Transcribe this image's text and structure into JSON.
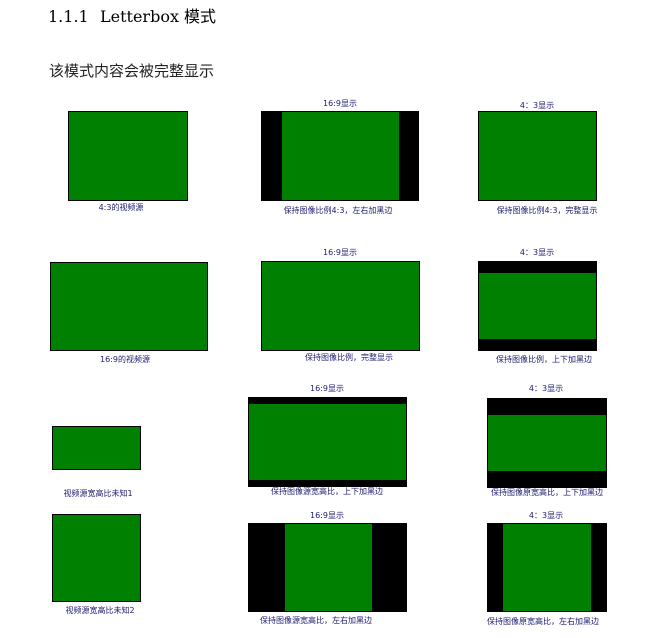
{
  "heading": {
    "number": "1.1.1",
    "title": "Letterbox 模式"
  },
  "subheading": "该模式内容会被完整显示",
  "colors": {
    "content": "#008000",
    "bars": "#000000",
    "caption": "#1a1a6e"
  },
  "rows": [
    {
      "source": {
        "caption": "4:3的视频源"
      },
      "display_169": {
        "title": "16:9显示",
        "caption": "保持图像比例4:3，左右加黑边"
      },
      "display_43": {
        "title": "4：3显示",
        "caption": "保持图像比例4:3，完整显示"
      }
    },
    {
      "source": {
        "caption": "16:9的视频源"
      },
      "display_169": {
        "title": "16:9显示",
        "caption": "保持图像比例，完整显示"
      },
      "display_43": {
        "title": "4：3显示",
        "caption": "保持图像比例，上下加黑边"
      }
    },
    {
      "source": {
        "caption": "视频源宽高比未知1"
      },
      "display_169": {
        "title": "16:9显示",
        "caption": "保持图像源宽高比，上下加黑边"
      },
      "display_43": {
        "title": "4：3显示",
        "caption": "保持图像原宽高比，上下加黑边"
      }
    },
    {
      "source": {
        "caption": "视频源宽高比未知2"
      },
      "display_169": {
        "title": "16:9显示",
        "caption": "保持图像源宽高比，左右加黑边"
      },
      "display_43": {
        "title": "4：3显示",
        "caption": "保持图像原宽高比，左右加黑边"
      }
    }
  ]
}
